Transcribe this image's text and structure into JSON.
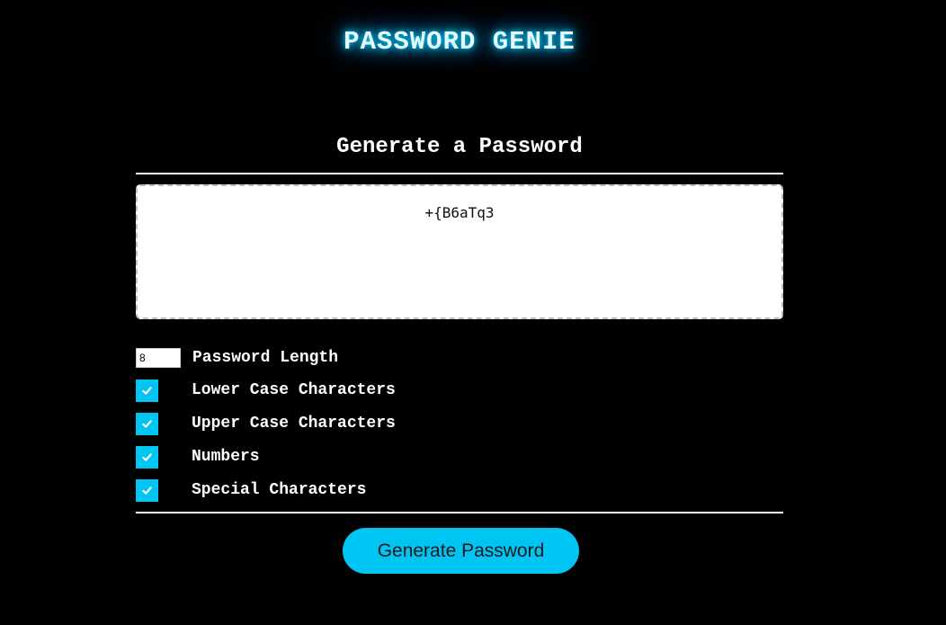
{
  "header": {
    "title": "PASSWORD GENIE"
  },
  "generator": {
    "section_title": "Generate a Password",
    "output_value": "+{B6aTq3"
  },
  "options": {
    "length": {
      "value": "8",
      "label": "Password Length"
    },
    "lower_case": {
      "label": "Lower Case Characters",
      "checked": true
    },
    "upper_case": {
      "label": "Upper Case Characters",
      "checked": true
    },
    "numbers": {
      "label": "Numbers",
      "checked": true
    },
    "special": {
      "label": "Special Characters",
      "checked": true
    }
  },
  "actions": {
    "generate_label": "Generate Password"
  },
  "colors": {
    "background": "#000000",
    "accent": "#00c4f2",
    "title_glow": "#00c8ff",
    "text": "#ffffff"
  },
  "icons": {
    "checkbox_mark": "check-icon"
  }
}
